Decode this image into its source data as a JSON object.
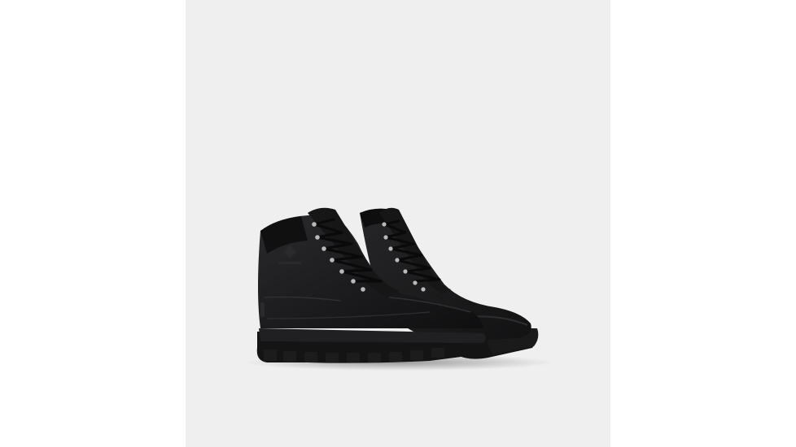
{
  "image": {
    "subject": "pair-of-black-leather-lace-up-boots",
    "brand_mark": "SOREL",
    "colors": {
      "page_background": "#ffffff",
      "panel_background": "#efefef",
      "boot_leather": "#1c1c1e",
      "sole": "#141414",
      "eyelets": "#b9b9b9"
    }
  }
}
